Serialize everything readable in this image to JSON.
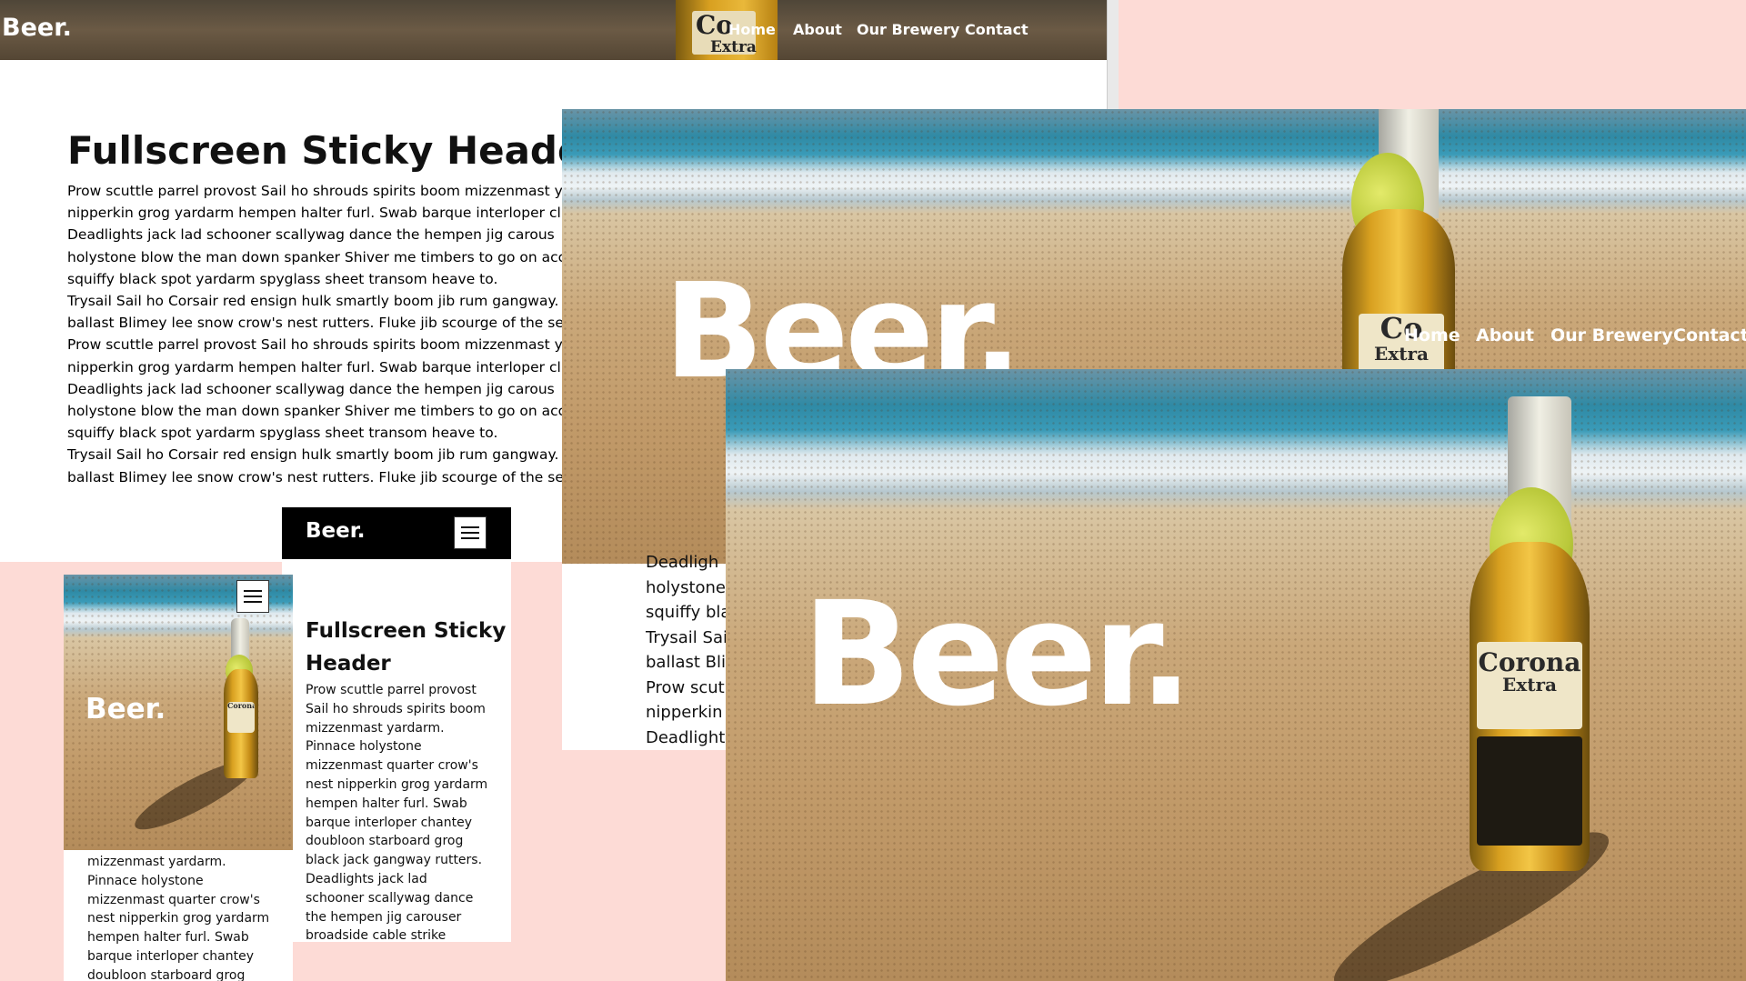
{
  "brand": "Beer.",
  "nav": [
    "Home",
    "About",
    "Our Brewery",
    "Contact"
  ],
  "heading": "Fullscreen Sticky Header",
  "heading_mobile_line1": "Fullscreen Sticky",
  "heading_mobile_line2": "Header",
  "desktop_paragraph_lines": [
    "Prow scuttle parrel provost Sail ho shrouds spirits boom mizzenmast y",
    "nipperkin grog yardarm hempen halter furl. Swab barque interloper cl",
    "Deadlights jack lad schooner scallywag dance the hempen jig carous",
    "holystone blow the man down spanker Shiver me timbers to go on acc",
    "squiffy black spot yardarm spyglass sheet transom heave to.",
    "Trysail Sail ho Corsair red ensign hulk smartly boom jib rum gangway.",
    "ballast Blimey lee snow crow's nest rutters. Fluke jib scourge of the sev",
    "Prow scuttle parrel provost Sail ho shrouds spirits boom mizzenmast y",
    "nipperkin grog yardarm hempen halter furl. Swab barque interloper cl",
    "Deadlights jack lad schooner scallywag dance the hempen jig carous",
    "holystone blow the man down spanker Shiver me timbers to go on acc",
    "squiffy black spot yardarm spyglass sheet transom heave to.",
    "Trysail Sail ho Corsair red ensign hulk smartly boom jib rum gangway.",
    "ballast Blimey lee snow crow's nest rutters. Fluke jib scourge of the sev"
  ],
  "tablet_paragraph_lines": [
    "Prow scuttle parrel provost",
    "Sail ho shrouds spirits boom",
    "mizzenmast yardarm.",
    "Pinnace holystone",
    "mizzenmast quarter crow's",
    "nest nipperkin grog yardarm",
    "hempen halter furl. Swab",
    "barque interloper chantey",
    "doubloon starboard grog",
    "black jack gangway rutters.",
    "Deadlights jack lad",
    "schooner scallywag dance",
    "the hempen jig carouser",
    "broadside cable strike"
  ],
  "phone_paragraph_lines": [
    "mizzenmast yardarm.",
    "Pinnace holystone",
    "mizzenmast quarter crow's",
    "nest nipperkin grog yardarm",
    "hempen halter furl. Swab",
    "barque interloper chantey",
    "doubloon starboard grog"
  ],
  "middle_partial_lines": [
    "Deadligh",
    "holystone",
    "squiffy bla",
    "Trysail Sai",
    "ballast Bli",
    "Prow scut",
    "nipperkin",
    "Deadlights"
  ],
  "bottle_label_short": [
    "Co",
    "Extra"
  ],
  "bottle_label_full": [
    "Corona",
    "Extra"
  ],
  "colors": {
    "page_bg": "#fddbd6",
    "nav_bg": "#000000",
    "text": "#111111",
    "white": "#ffffff"
  },
  "icons": [
    "hamburger-menu-icon"
  ]
}
